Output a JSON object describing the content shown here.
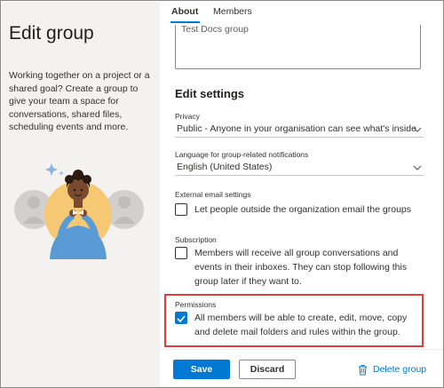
{
  "left": {
    "title": "Edit group",
    "description": "Working together on a project or a shared goal? Create a group to give your team a space for conversations, shared files, scheduling events and more."
  },
  "tabs": [
    {
      "label": "About",
      "active": true
    },
    {
      "label": "Members",
      "active": false
    }
  ],
  "description_field": {
    "value": "Test Docs group"
  },
  "edit_settings": {
    "title": "Edit settings",
    "privacy": {
      "label": "Privacy",
      "value": "Public - Anyone in your organisation can see what's inside"
    },
    "language": {
      "label": "Language for group-related notifications",
      "value": "English (United States)"
    },
    "external_email": {
      "label": "External email settings",
      "checkbox_label": "Let people outside the organization email the groups",
      "checked": false
    },
    "subscription": {
      "label": "Subscription",
      "checkbox_label": "Members will receive all group conversations and events in their inboxes. They can stop following this group later if they want to.",
      "checked": false
    },
    "permissions": {
      "label": "Permissions",
      "checkbox_label": "All members will be able to create, edit, move, copy and delete mail folders and rules within the group.",
      "checked": true
    }
  },
  "footer": {
    "save_label": "Save",
    "discard_label": "Discard",
    "delete_label": "Delete group"
  },
  "colors": {
    "accent": "#0078d4",
    "highlight": "#e03c3c"
  }
}
